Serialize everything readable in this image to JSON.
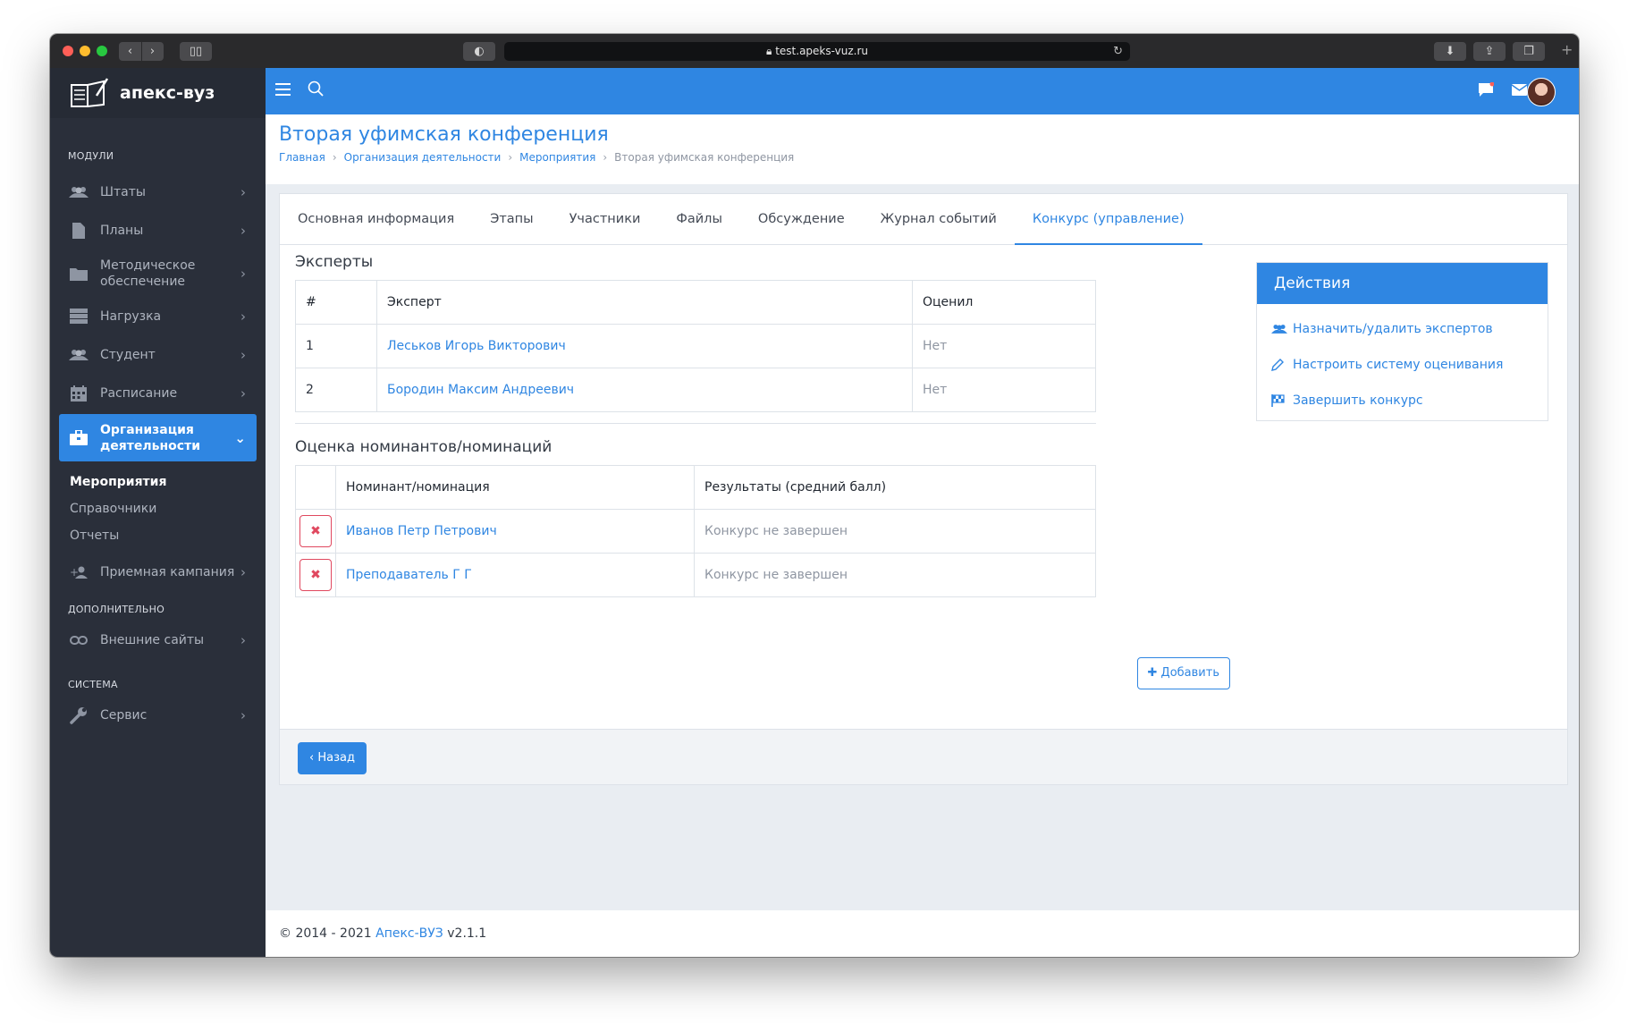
{
  "browser": {
    "url": "test.apeks-vuz.ru"
  },
  "app": {
    "logo_text": "апекс-вуз"
  },
  "sidebar": {
    "sections": {
      "modules": "МОДУЛИ",
      "additional": "ДОПОЛНИТЕЛЬНО",
      "system": "СИСТЕМА"
    },
    "items": [
      {
        "label": "Штаты",
        "icon": "users-icon"
      },
      {
        "label": "Планы",
        "icon": "file-icon"
      },
      {
        "label": "Методическое обеспечение",
        "icon": "folder-icon"
      },
      {
        "label": "Нагрузка",
        "icon": "server-icon"
      },
      {
        "label": "Студент",
        "icon": "users-icon"
      },
      {
        "label": "Расписание",
        "icon": "calendar-icon"
      },
      {
        "label": "Организация деятельности",
        "icon": "briefcase-icon"
      },
      {
        "label": "Приемная кампания",
        "icon": "user-plus-icon"
      },
      {
        "label": "Внешние сайты",
        "icon": "link-icon"
      },
      {
        "label": "Сервис",
        "icon": "wrench-icon"
      }
    ],
    "subitems": [
      "Мероприятия",
      "Справочники",
      "Отчеты"
    ]
  },
  "page": {
    "title": "Вторая уфимская конференция",
    "breadcrumb": [
      "Главная",
      "Организация деятельности",
      "Мероприятия",
      "Вторая уфимская конференция"
    ]
  },
  "tabs": [
    "Основная информация",
    "Этапы",
    "Участники",
    "Файлы",
    "Обсуждение",
    "Журнал событий",
    "Конкурс (управление)"
  ],
  "experts": {
    "title": "Эксперты",
    "headers": [
      "#",
      "Эксперт",
      "Оценил"
    ],
    "rows": [
      {
        "num": "1",
        "name": "Леськов Игорь Викторович",
        "rated": "Нет"
      },
      {
        "num": "2",
        "name": "Бородин Максим Андреевич",
        "rated": "Нет"
      }
    ]
  },
  "nominees": {
    "title": "Оценка номинантов/номинаций",
    "headers": [
      "Номинант/номинация",
      "Результаты (средний балл)"
    ],
    "rows": [
      {
        "name": "Иванов Петр Петрович",
        "result": "Конкурс не завершен"
      },
      {
        "name": "Преподаватель Г Г",
        "result": "Конкурс не завершен"
      }
    ],
    "add_label": "Добавить"
  },
  "actions": {
    "title": "Действия",
    "links": [
      "Назначить/удалить экспертов",
      "Настроить систему оценивания",
      "Завершить конкурс"
    ]
  },
  "back_label": "Назад",
  "footer": {
    "prefix": "© 2014 - 2021",
    "brand": "Апекс-ВУЗ",
    "version": "v2.1.1"
  },
  "colors": {
    "accent": "#2f86e2",
    "sidebar_bg": "#2a2f3a",
    "danger": "#e0485f"
  }
}
